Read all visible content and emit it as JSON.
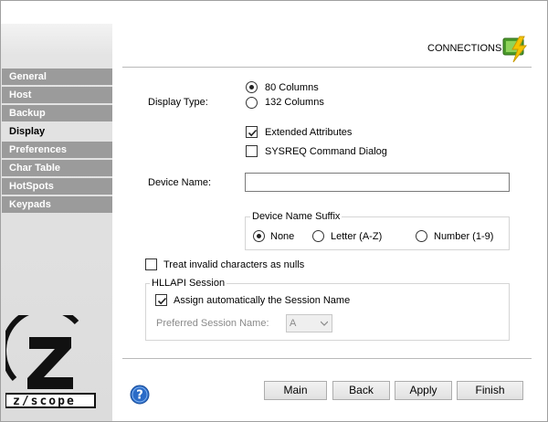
{
  "header": {
    "title": "CONNECTIONS",
    "icon": "connections-lightning-icon"
  },
  "sidebar": {
    "items": [
      {
        "label": "General"
      },
      {
        "label": "Host"
      },
      {
        "label": "Backup"
      },
      {
        "label": "Display",
        "active": true
      },
      {
        "label": "Preferences"
      },
      {
        "label": "Char Table"
      },
      {
        "label": "HotSpots"
      },
      {
        "label": "Keypads"
      }
    ],
    "logo_text": "zscope"
  },
  "display_type": {
    "label": "Display Type:",
    "options": [
      {
        "label": "80 Columns",
        "selected": true
      },
      {
        "label": "132 Columns",
        "selected": false
      }
    ]
  },
  "extended_attributes": {
    "label": "Extended Attributes",
    "checked": true
  },
  "sysreq_dialog": {
    "label": "SYSREQ Command Dialog",
    "checked": false
  },
  "device_name": {
    "label": "Device Name:",
    "value": ""
  },
  "device_name_suffix": {
    "title": "Device Name Suffix",
    "options": [
      {
        "label": "None",
        "selected": true
      },
      {
        "label": "Letter (A-Z)",
        "selected": false
      },
      {
        "label": "Number (1-9)",
        "selected": false
      }
    ]
  },
  "treat_invalid_nulls": {
    "label": "Treat invalid characters as nulls",
    "checked": false
  },
  "hllapi": {
    "title": "HLLAPI Session",
    "assign_auto": {
      "label": "Assign automatically the Session Name",
      "checked": true
    },
    "preferred_label": "Preferred Session Name:",
    "preferred_value": "A"
  },
  "buttons": {
    "main": "Main",
    "back": "Back",
    "apply": "Apply",
    "finish": "Finish"
  },
  "colors": {
    "sidebar_item_bg": "#9b9b9b",
    "sidebar_bg": "#dcdcdc",
    "accent_green": "#6dbf3a",
    "accent_yellow": "#f5c400",
    "help_blue": "#2a6bc7"
  }
}
